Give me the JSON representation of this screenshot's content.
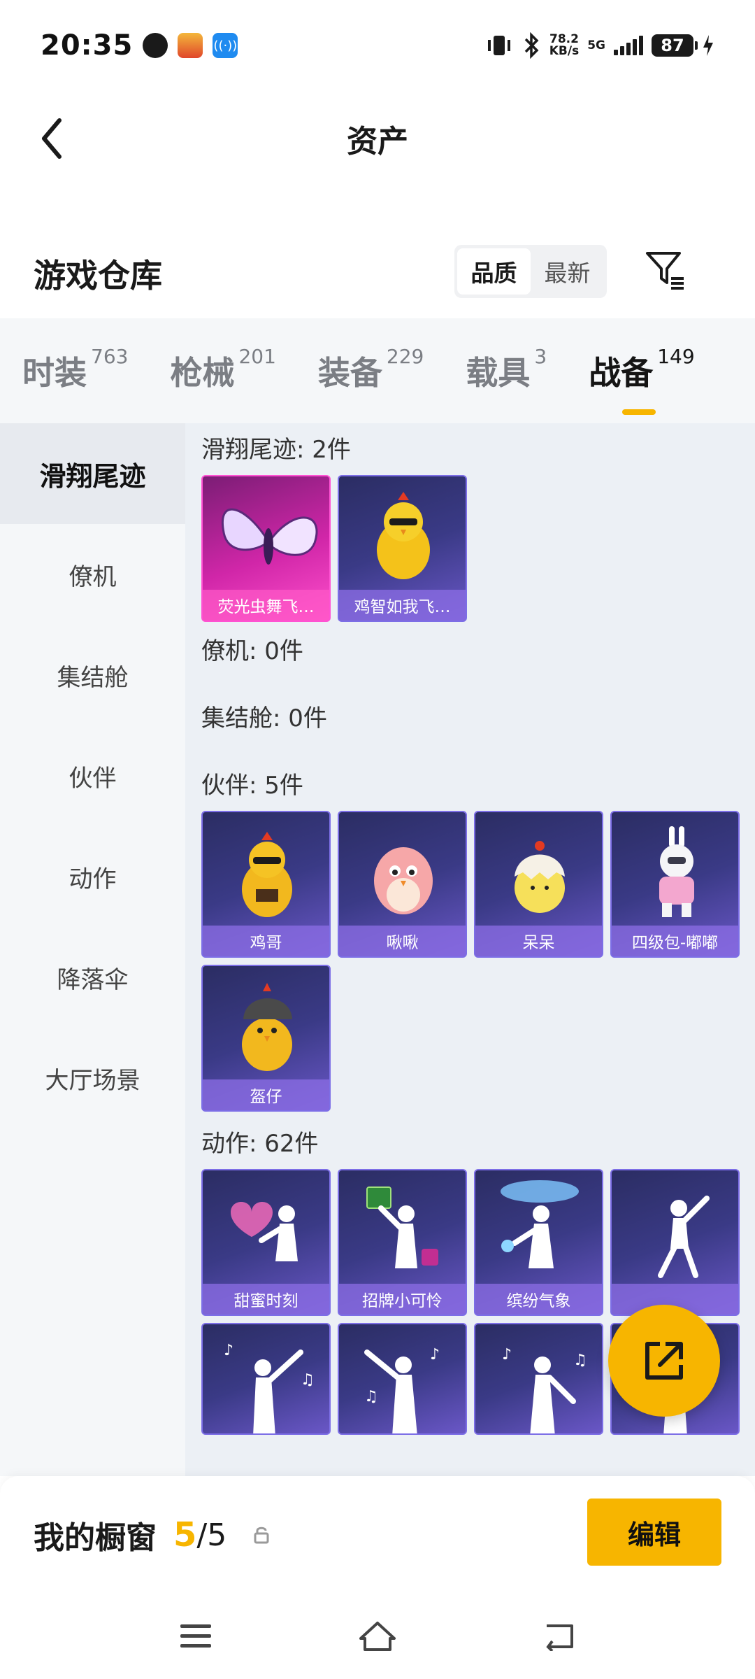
{
  "status_bar": {
    "time": "20:35",
    "speed_value": "78.2",
    "speed_unit": "KB/s",
    "network": "5G",
    "battery": "87"
  },
  "header": {
    "title": "资产"
  },
  "warehouse": {
    "title": "游戏仓库",
    "sort_options": [
      "品质",
      "最新"
    ],
    "sort_selected": "品质"
  },
  "tabs": [
    {
      "label": "时装",
      "count": "763"
    },
    {
      "label": "枪械",
      "count": "201"
    },
    {
      "label": "装备",
      "count": "229"
    },
    {
      "label": "载具",
      "count": "3"
    },
    {
      "label": "战备",
      "count": "149"
    }
  ],
  "active_tab": "战备",
  "side_nav": [
    "滑翔尾迹",
    "僚机",
    "集结舱",
    "伙伴",
    "动作",
    "降落伞",
    "大厅场景"
  ],
  "active_side": "滑翔尾迹",
  "sections": {
    "glide": {
      "title": "滑翔尾迹: 2件",
      "items": [
        "荧光虫舞飞…",
        "鸡智如我飞…"
      ]
    },
    "wingman": {
      "title": "僚机: 0件"
    },
    "pod": {
      "title": "集结舱: 0件"
    },
    "partner": {
      "title": "伙伴: 5件",
      "items": [
        "鸡哥",
        "啾啾",
        "呆呆",
        "四级包-嘟嘟",
        "盔仔"
      ]
    },
    "emote": {
      "title": "动作: 62件",
      "items": [
        "甜蜜时刻",
        "招牌小可怜",
        "缤纷气象",
        ""
      ]
    }
  },
  "bottom": {
    "showcase_label": "我的橱窗",
    "showcase_count": "5",
    "showcase_sep": "/",
    "showcase_total": "5",
    "edit_label": "编辑"
  },
  "colors": {
    "accent": "#f7b500",
    "card_purple": "#3a3a86",
    "card_pink": "#d026a8"
  },
  "icons": {
    "back": "back-arrow-icon",
    "filter": "filter-icon",
    "share": "share-icon",
    "lock": "lock-icon"
  }
}
